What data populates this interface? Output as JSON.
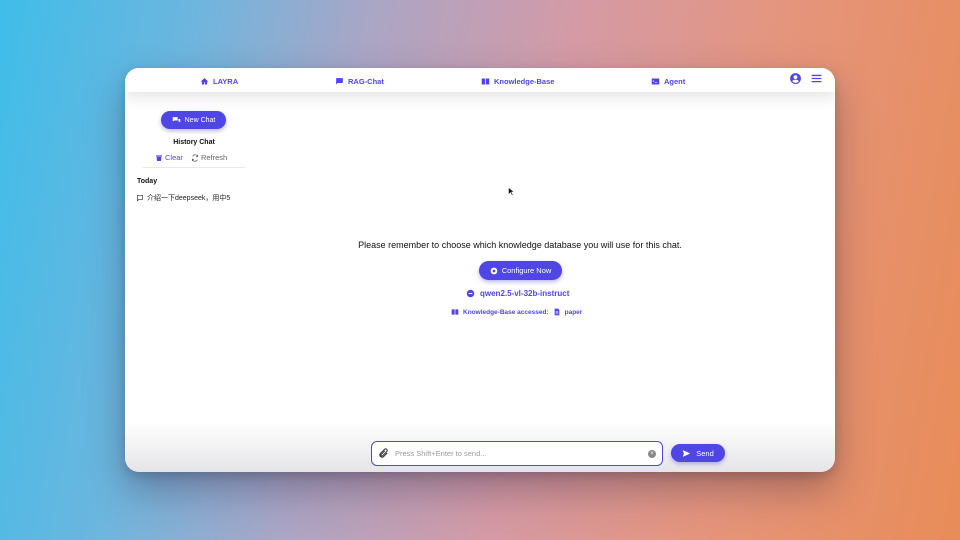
{
  "nav": {
    "items": [
      {
        "label": "LAYRA",
        "icon": "home-icon"
      },
      {
        "label": "RAG-Chat",
        "icon": "chat-icon"
      },
      {
        "label": "Knowledge-Base",
        "icon": "book-icon"
      },
      {
        "label": "Agent",
        "icon": "terminal-icon"
      }
    ],
    "user_icon": "user-circle-icon",
    "menu_icon": "hamburger-menu-icon"
  },
  "sidebar": {
    "new_chat_label": "New Chat",
    "history_title": "History Chat",
    "clear_label": "Clear",
    "refresh_label": "Refresh",
    "today_label": "Today",
    "items": [
      {
        "label": "介绍一下deepseek，用中5"
      }
    ]
  },
  "main": {
    "reminder": "Please remember to choose which knowledge database you will use for this chat.",
    "configure_label": "Configure Now",
    "model_name": "qwen2.5-vl-32b-instruct",
    "kb_accessed_label": "Knowledge-Base accessed:",
    "kb_name": "paper"
  },
  "input": {
    "placeholder": "Press Shift+Enter to send...",
    "value": ""
  },
  "send_label": "Send",
  "colors": {
    "accent": "#4f46e5",
    "window_bg": "#ffffff"
  }
}
